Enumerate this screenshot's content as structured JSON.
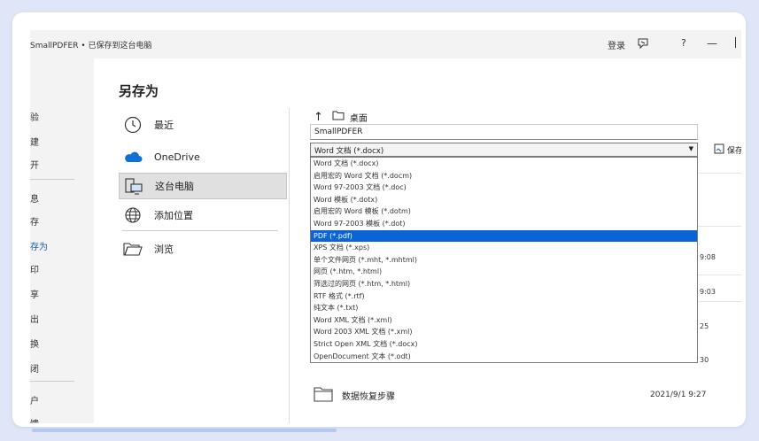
{
  "window": {
    "title": "SmallPDFER • 已保存到这台电脑",
    "login": "登录",
    "help": "?",
    "minimize": "—"
  },
  "leftnav": {
    "items": [
      "验",
      "建",
      "开",
      "息",
      "存",
      "存为",
      "印",
      "享",
      "出",
      "换",
      "闭",
      "户",
      "馈"
    ],
    "active_index": 5
  },
  "heading": "另存为",
  "locations": [
    {
      "label": "最近",
      "icon": "clock-icon"
    },
    {
      "label": "OneDrive",
      "icon": "cloud-icon"
    },
    {
      "label": "这台电脑",
      "icon": "computer-icon"
    },
    {
      "label": "添加位置",
      "icon": "globe-icon"
    },
    {
      "label": "浏览",
      "icon": "folder-open-icon"
    }
  ],
  "selected_location_index": 2,
  "path": {
    "up_arrow": "↑",
    "current": "桌面"
  },
  "filename": "SmallPDFER",
  "filetype": {
    "selected": "Word 文档 (*.docx)",
    "options": [
      "Word 文档 (*.docx)",
      "启用宏的 Word 文档 (*.docm)",
      "Word 97-2003 文档 (*.doc)",
      "Word 模板 (*.dotx)",
      "启用宏的 Word 模板 (*.dotm)",
      "Word 97-2003 模板 (*.dot)",
      "PDF (*.pdf)",
      "XPS 文档 (*.xps)",
      "单个文件网页 (*.mht, *.mhtml)",
      "网页 (*.htm, *.html)",
      "筛选过的网页 (*.htm, *.html)",
      "RTF 格式 (*.rtf)",
      "纯文本 (*.txt)",
      "Word XML 文档 (*.xml)",
      "Word 2003 XML 文档 (*.xml)",
      "Strict Open XML 文档 (*.docx)",
      "OpenDocument 文本 (*.odt)"
    ],
    "highlighted_index": 6
  },
  "save_label": "保存",
  "right_fragments": [
    "9:08",
    "9:03",
    "25",
    "30"
  ],
  "files": [
    {
      "name": "数据恢复步骤",
      "date": "2021/9/1 9:27"
    }
  ],
  "colors": {
    "accent": "#0a64d6",
    "frame_bg": "#dfe6f7",
    "nav_bg": "#f3f3f3"
  }
}
